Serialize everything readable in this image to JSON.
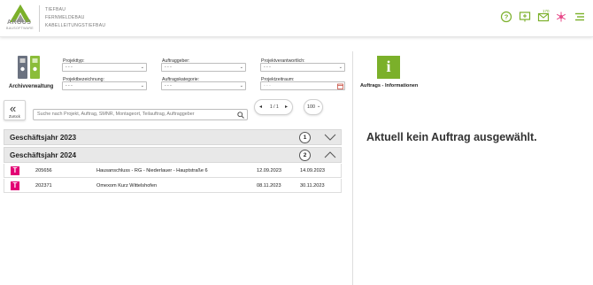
{
  "header": {
    "logo_text": "ARGUS",
    "logo_sub": "BAUSOFTWARE",
    "company_lines": [
      "TIEFBAU",
      "FERNMELDEBAU",
      "KABELLEITUNGSTIEFBAU"
    ],
    "notification_count": "170",
    "accent_color": "#7bb02a",
    "icons": [
      "help-icon",
      "message-board-icon",
      "mail-icon",
      "settings-flower-icon",
      "menu-icon"
    ]
  },
  "left": {
    "archive_label": "Archivverwaltung",
    "filters": {
      "projekttyp": {
        "label": "Projekttyp:",
        "value": "- - -"
      },
      "auftraggeber": {
        "label": "Auftraggeber:",
        "value": "- - -"
      },
      "projektverantwortlich": {
        "label": "Projektverantwortlich:",
        "value": "- - -"
      },
      "projektbezeichnung": {
        "label": "Projektbezeichnung:",
        "value": "- - -"
      },
      "auftragskategorie": {
        "label": "Auftragskategorie:",
        "value": "- - -"
      },
      "projektzeitraum": {
        "label": "Projektzeitraum:",
        "value": "- - -"
      }
    },
    "back_label": "Zurück",
    "search_placeholder": "Suche nach Projekt, Auftrag, SMNR, Montageort, Teilauftrag, Auftraggeber",
    "pager": {
      "page_text": "1 / 1",
      "per_page": "100"
    },
    "years": [
      {
        "title": "Geschäftsjahr 2023",
        "count": "1",
        "expanded": false
      },
      {
        "title": "Geschäftsjahr 2024",
        "count": "2",
        "expanded": true
      }
    ],
    "rows": [
      {
        "logo": "T",
        "number": "205656",
        "name": "Hausanschluss - RG - Niederlauer - Hauptstraße 6",
        "start": "12.09.2023",
        "end": "14.09.2023"
      },
      {
        "logo": "T",
        "number": "202371",
        "name": "Omexom Kurz Wittelshofen",
        "start": "08.11.2023",
        "end": "30.11.2023"
      }
    ]
  },
  "right": {
    "info_icon": "i",
    "info_label": "Auftrags - Informationen",
    "empty_message": "Aktuell kein Auftrag ausgewählt."
  }
}
